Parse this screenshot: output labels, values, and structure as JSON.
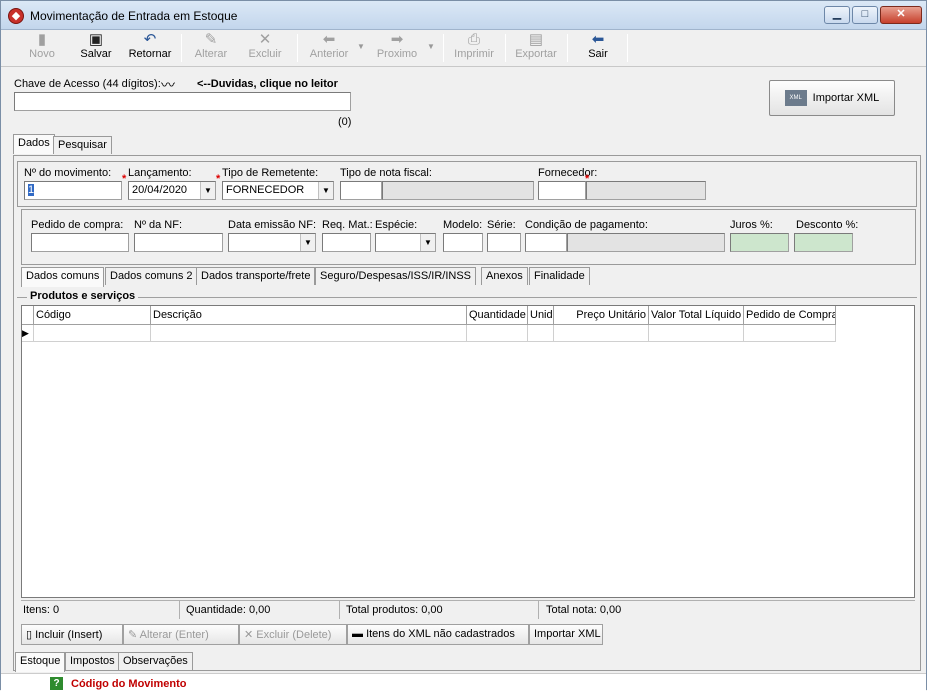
{
  "window": {
    "title": "Movimentação de Entrada em Estoque",
    "icon": "app-logo-icon"
  },
  "toolbar": {
    "novo": "Novo",
    "salvar": "Salvar",
    "retornar": "Retornar",
    "alterar": "Alterar",
    "excluir": "Excluir",
    "anterior": "Anterior",
    "proximo": "Proximo",
    "imprimir": "Imprimir",
    "exportar": "Exportar",
    "sair": "Sair"
  },
  "chave": {
    "label": "Chave de Acesso (44 dígitos):",
    "hint": "<--Duvidas, clique no leitor",
    "value": "",
    "count": "(0)"
  },
  "importar_xml": "Importar XML",
  "top_tabs": [
    "Dados",
    "Pesquisar"
  ],
  "header_fields": {
    "num_mov_label": "Nº do movimento:",
    "num_mov_value": "1",
    "lancamento_label": "Lançamento:",
    "lancamento_value": "20/04/2020",
    "tipo_rem_label": "Tipo de Remetente:",
    "tipo_rem_value": "FORNECEDOR",
    "tipo_nota_label": "Tipo de nota fiscal:",
    "fornecedor_label": "Fornecedor:"
  },
  "detail_fields": {
    "pedido": "Pedido de compra:",
    "num_nf": "Nº da NF:",
    "data_emissao": "Data emissão NF:",
    "req_mat": "Req. Mat.:",
    "especie": "Espécie:",
    "modelo": "Modelo:",
    "serie": "Série:",
    "condicao": "Condição de pagamento:",
    "juros": "Juros %:",
    "desconto": "Desconto %:"
  },
  "sub_tabs": [
    "Dados comuns",
    "Dados comuns 2",
    "Dados transporte/frete",
    "Seguro/Despesas/ISS/IR/INSS",
    "Anexos",
    "Finalidade"
  ],
  "produtos": {
    "title": "Produtos e serviços",
    "columns": [
      "Código",
      "Descrição",
      "Quantidade",
      "Unid",
      "Preço Unitário",
      "Valor Total Líquido",
      "Pedido de Compra"
    ]
  },
  "status": {
    "itens": "Itens: 0",
    "quantidade": "Quantidade: 0,00",
    "total_produtos": "Total produtos: 0,00",
    "total_nota": "Total nota: 0,00"
  },
  "grid_buttons": {
    "incluir": "Incluir (Insert)",
    "alterar": "Alterar (Enter)",
    "excluir": "Excluir (Delete)",
    "itens_xml": "Itens do XML não cadastrados",
    "importar_xml": "Importar XML"
  },
  "bottom_tabs": [
    "Estoque",
    "Impostos",
    "Observações"
  ],
  "bottom_strip": {
    "text": "Código do Movimento",
    "icon": "help-icon"
  }
}
